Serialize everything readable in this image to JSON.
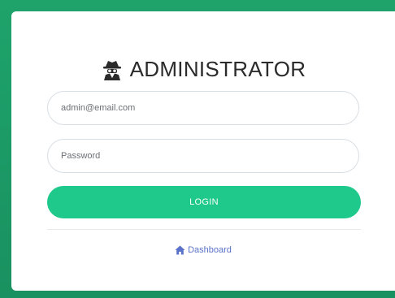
{
  "header": {
    "title": "ADMINISTRATOR",
    "icon": "user-secret-icon"
  },
  "form": {
    "email_placeholder": "admin@email.com",
    "email_value": "",
    "password_placeholder": "Password",
    "password_value": "",
    "login_label": "LOGIN"
  },
  "footer": {
    "dashboard_label": "Dashboard",
    "dashboard_icon": "home-icon"
  },
  "colors": {
    "background": "#1b9a66",
    "accent": "#1ec98b",
    "link": "#5a72c9",
    "title": "#2b2b2b"
  }
}
